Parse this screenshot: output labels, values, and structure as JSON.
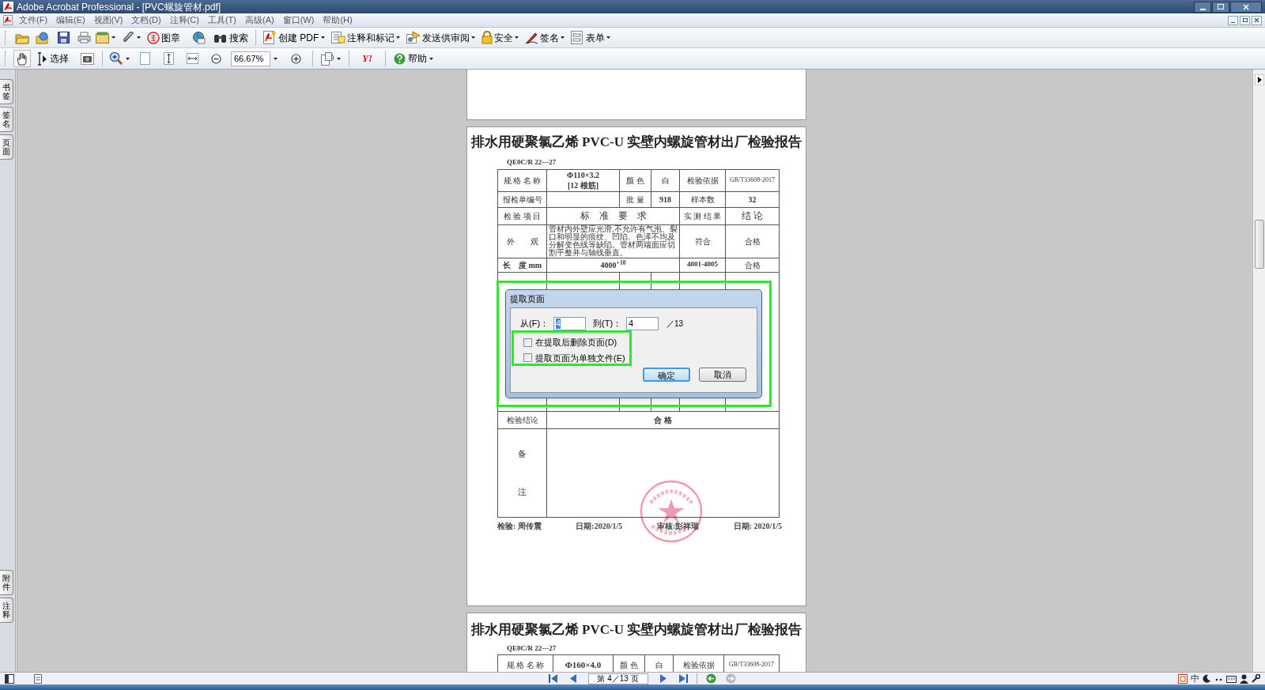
{
  "window": {
    "title": "Adobe Acrobat Professional - [PVC螺旋管材.pdf]"
  },
  "menu": [
    "文件(F)",
    "编辑(E)",
    "视图(V)",
    "文档(D)",
    "注释(C)",
    "工具(T)",
    "高级(A)",
    "窗口(W)",
    "帮助(H)"
  ],
  "toolbar_1": {
    "stamp": "图章",
    "search": "搜索",
    "create_pdf": "创建 PDF",
    "comment": "注释和标记",
    "review": "发送供审阅",
    "security": "安全",
    "sign": "签名",
    "forms": "表单"
  },
  "toolbar_2": {
    "select": "选择",
    "zoom": "66.67%",
    "logo": "Y!",
    "help": "帮助"
  },
  "side_tabs_top": [
    "书签",
    "签名",
    "页面"
  ],
  "side_tabs_bottom": [
    "附件",
    "注释"
  ],
  "page_4": {
    "title": "排水用硬聚氯乙烯 PVC-U 实壁内螺旋管材出厂检验报告",
    "code": "QE0C/R 22---27",
    "rows": [
      [
        "规 格 名 称",
        "Φ110×3.2\n[12 根筋]",
        "颜 色",
        "白",
        "检验依据",
        "GB/T33608-2017"
      ],
      [
        "报检单编号",
        "",
        "批 量",
        "918",
        "样本数",
        "32"
      ],
      [
        "检 验 项 目",
        {
          "text": "标　准　要　求",
          "colspan": 3
        },
        "实 测 结 果",
        "结 论"
      ],
      [
        "外　　观",
        {
          "text": "管材内外壁应光滑,不允许有气泡、裂口和明显的痕纹、凹陷、色泽不均及分解变色线等缺陷。管材两端面应切割平整并与轴线垂直。",
          "colspan": 3
        },
        "符合",
        "合格"
      ],
      [
        "长　度 mm",
        {
          "text": "4000$^{+10}$",
          "colspan": 3
        },
        "4001-4005",
        "合格"
      ]
    ],
    "conclusion_label": "检验结论",
    "conclusion": "合 格",
    "remarks": [
      "备",
      "注"
    ],
    "signatures": [
      "检验: 周传震",
      "日期:2020/1/5",
      "审核:彭祥瑞",
      "日期: 2020/1/5"
    ]
  },
  "page_5": {
    "title": "排水用硬聚氯乙烯 PVC-U 实壁内螺旋管材出厂检验报告",
    "code": "QE0C/R 22---27",
    "row": [
      "规 格 名 称",
      "Φ160×4.0",
      "颜 色",
      "白",
      "检验依据",
      "GB/T33608-2017"
    ]
  },
  "dialog": {
    "title": "提取页面",
    "from_label": "从(F)：",
    "from": "4",
    "to_label": "到(T)：",
    "to": "4",
    "total": "／13",
    "options": [
      {
        "label": "在提取后删除页面(D)",
        "checked": false
      },
      {
        "label": "提取页面为单独文件(E)",
        "checked": false
      }
    ],
    "buttons": [
      "确定",
      "取消"
    ]
  },
  "status_bar": {
    "page": "第 4／13 页",
    "ime": "中"
  }
}
